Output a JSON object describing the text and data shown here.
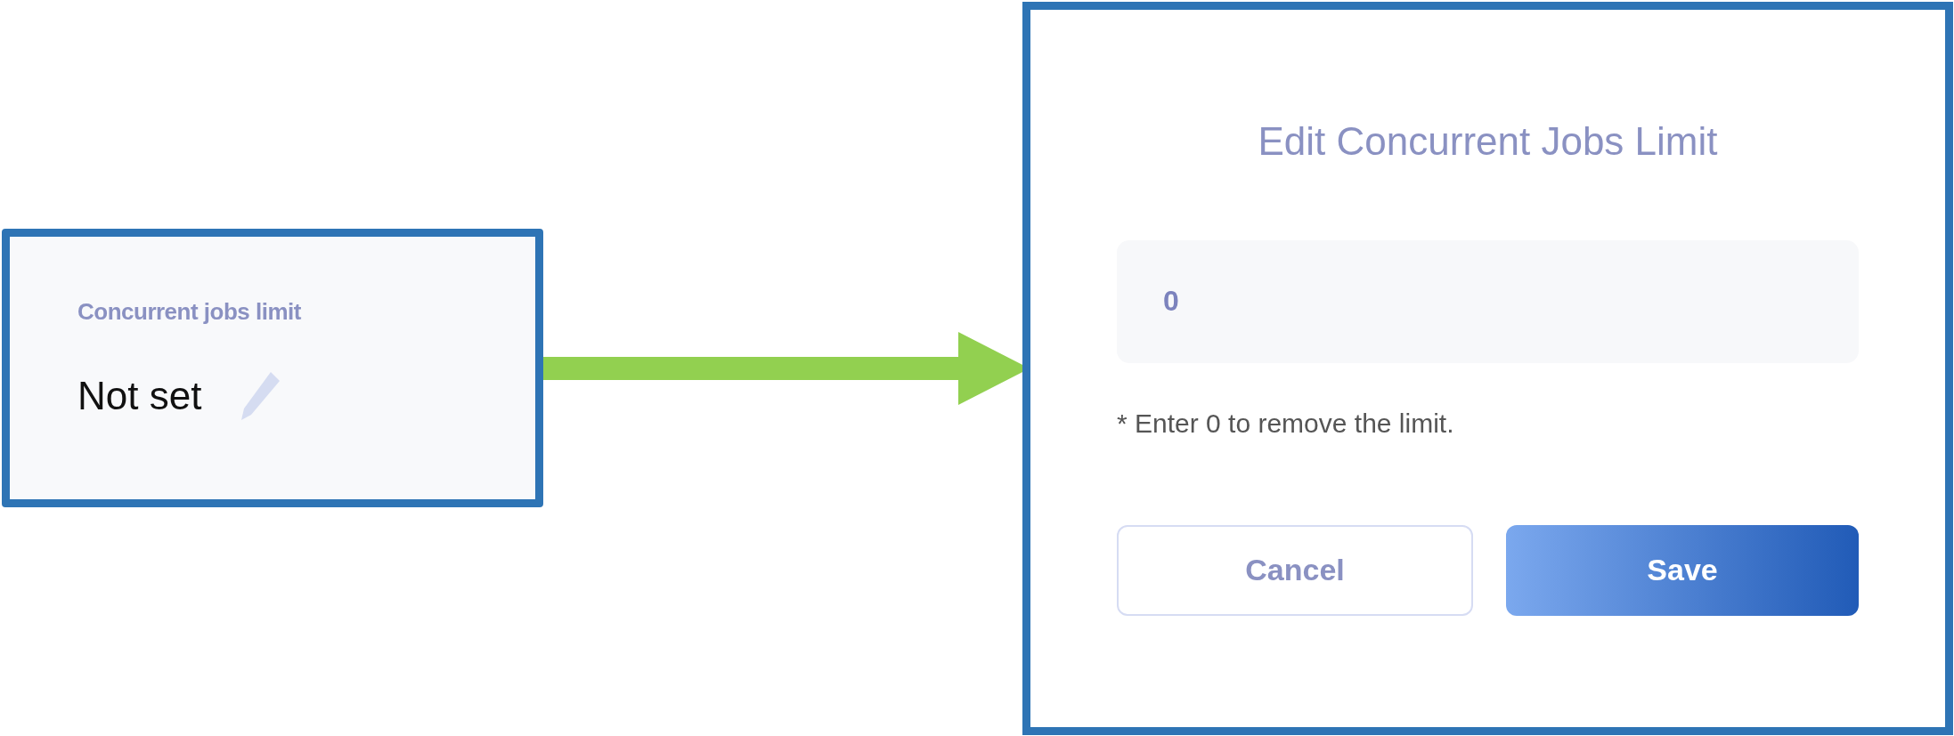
{
  "setting_card": {
    "label": "Concurrent jobs limit",
    "value": "Not set"
  },
  "dialog": {
    "title": "Edit Concurrent Jobs Limit",
    "input": {
      "value": "0"
    },
    "hint": "* Enter 0 to remove the limit.",
    "buttons": [
      {
        "label": "Cancel",
        "kind": "secondary"
      },
      {
        "label": "Save",
        "kind": "primary"
      }
    ]
  }
}
